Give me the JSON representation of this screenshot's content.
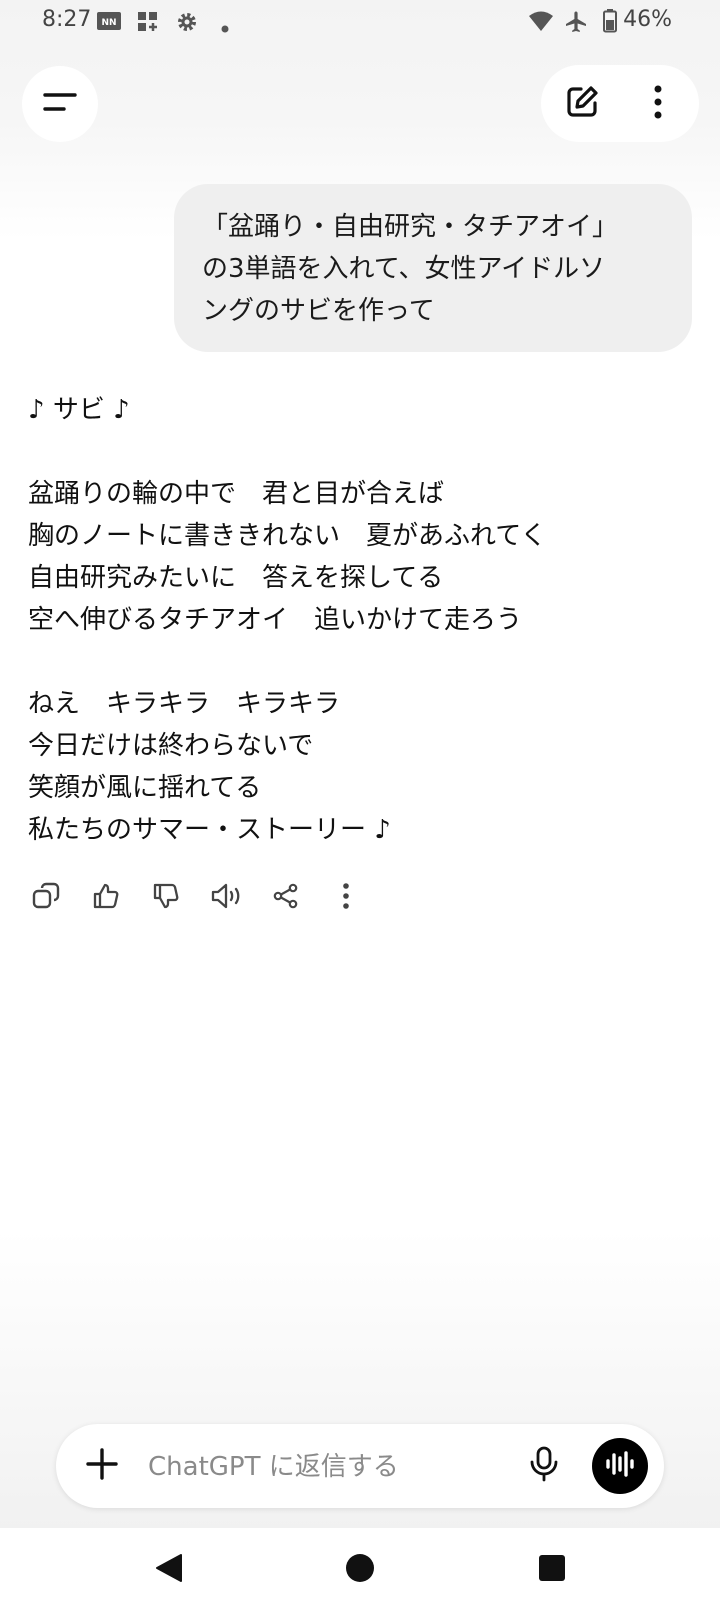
{
  "status_bar": {
    "time": "8:27",
    "battery_percent": "46%",
    "left_icons": [
      "news-app-icon",
      "widgets-icon",
      "settings-icon",
      "dot-icon"
    ],
    "right_icons": [
      "wifi-icon",
      "airplane-mode-icon",
      "battery-icon"
    ]
  },
  "header": {
    "menu_icon": "menu-icon",
    "new_chat_icon": "edit-icon",
    "more_icon": "more-vertical-icon"
  },
  "conversation": {
    "user_message": {
      "lines": [
        "「盆踊り・自由研究・タチアオイ」",
        "の3単語を入れて、女性アイドルソ",
        "ングのサビを作って"
      ]
    },
    "assistant_message": {
      "title": "♪ サビ ♪",
      "verse1": [
        "盆踊りの輪の中で　君と目が合えば",
        "胸のノートに書ききれない　夏があふれてく",
        "自由研究みたいに　答えを探してる",
        "空へ伸びるタチアオイ　追いかけて走ろう"
      ],
      "verse2": [
        "ねえ　キラキラ　キラキラ",
        "今日だけは終わらないで",
        "笑顔が風に揺れてる",
        "私たちのサマー・ストーリー ♪"
      ]
    },
    "actions": [
      "copy-icon",
      "thumbs-up-icon",
      "thumbs-down-icon",
      "read-aloud-icon",
      "share-icon",
      "more-vertical-icon"
    ]
  },
  "composer": {
    "placeholder": "ChatGPT に返信する",
    "value": ""
  },
  "nav_bar": [
    "back-icon",
    "home-icon",
    "recents-icon"
  ]
}
